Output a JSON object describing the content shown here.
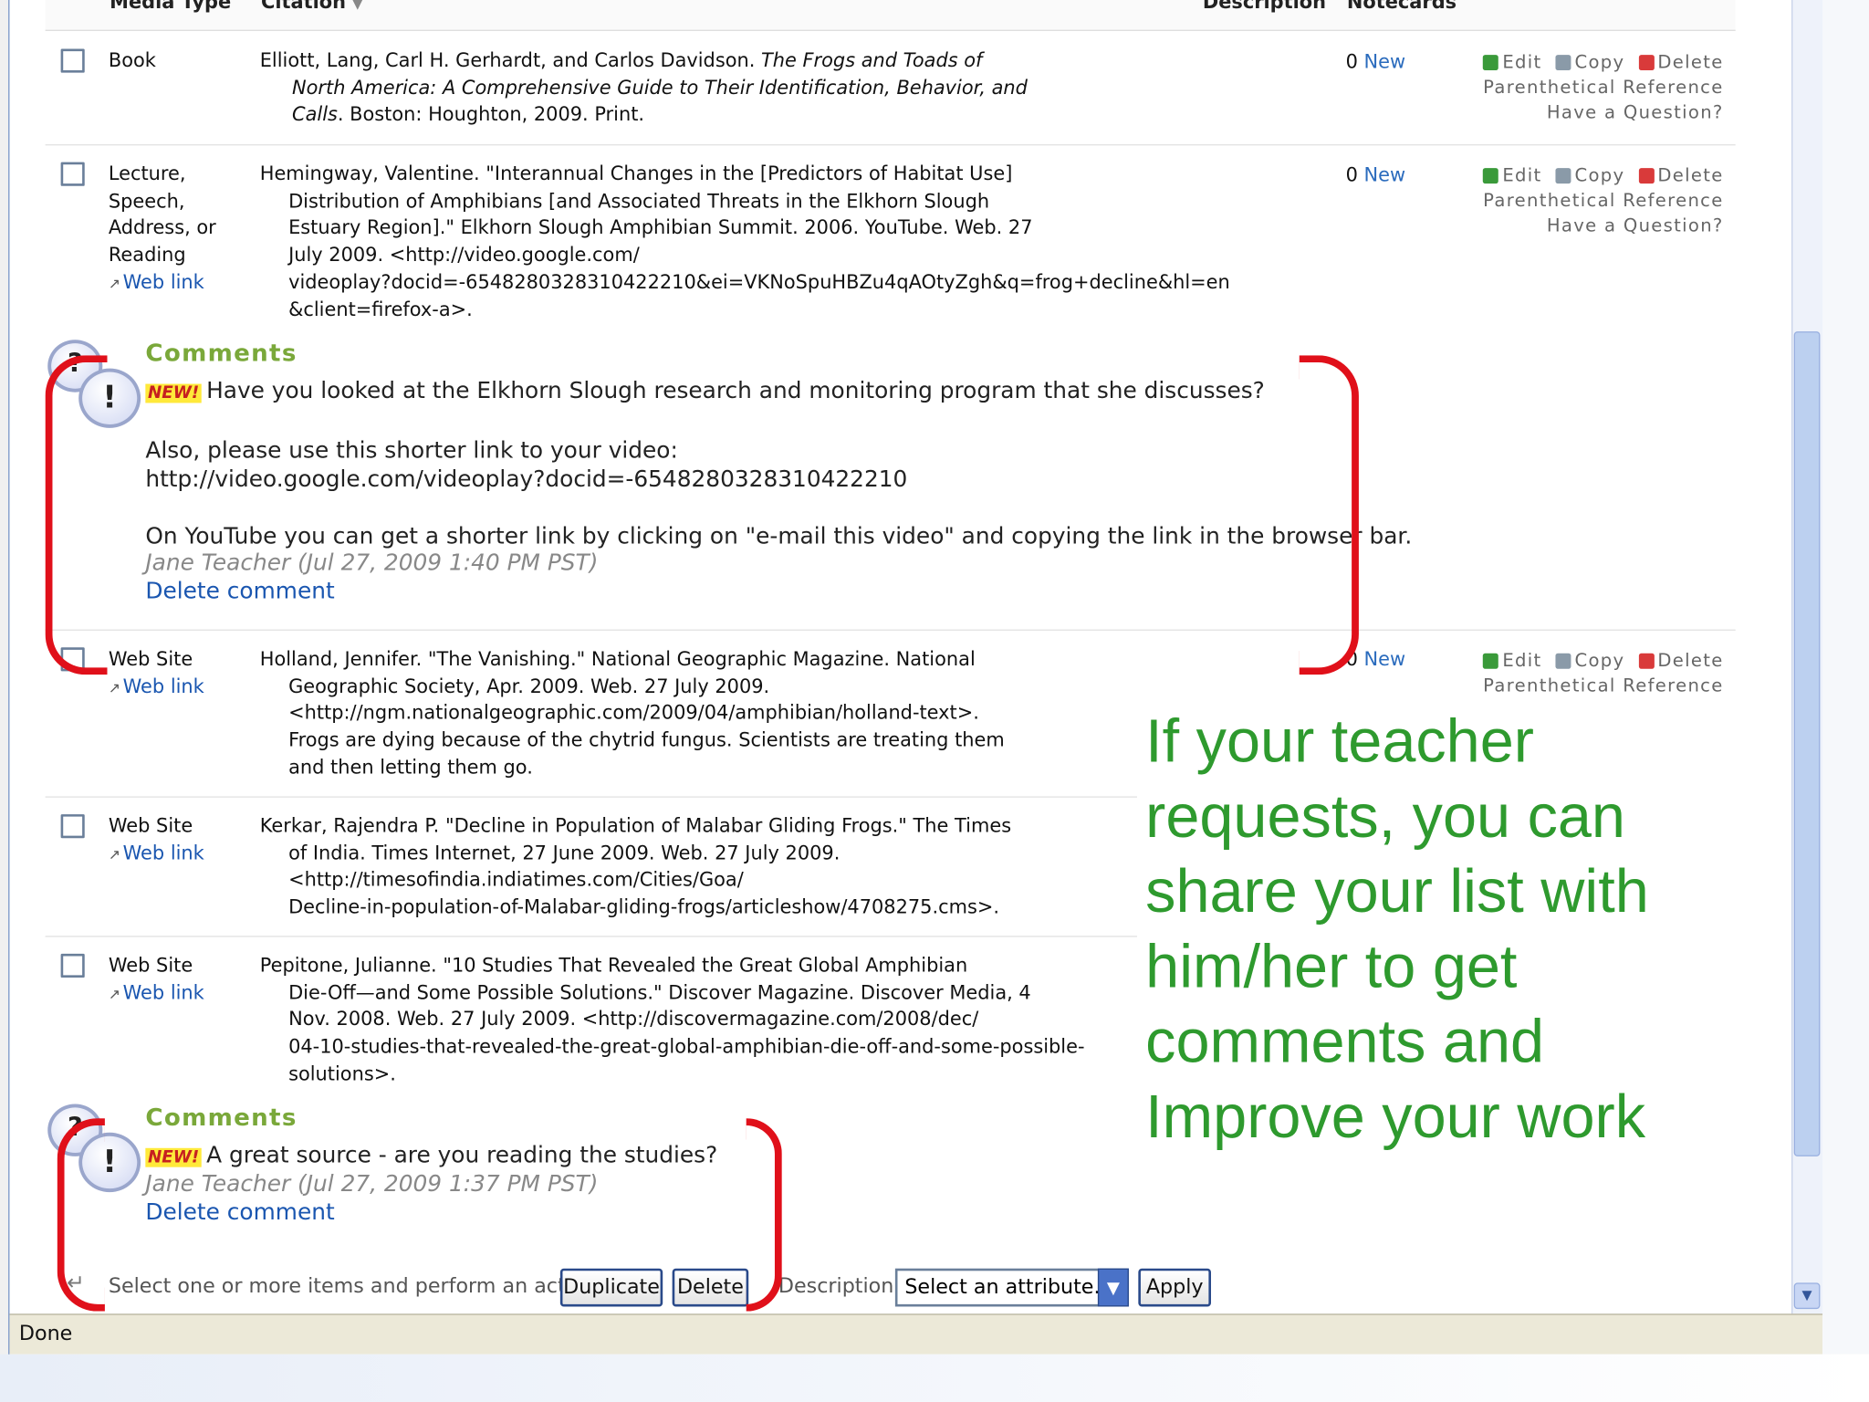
{
  "headers": {
    "media_type": "Media Type",
    "citation": "Citation",
    "description": "Description",
    "notecards": "Notecards"
  },
  "actions": {
    "edit": "Edit",
    "copy": "Copy",
    "delete": "Delete",
    "paren": "Parenthetical Reference",
    "question": "Have a Question?"
  },
  "web_link": "Web link",
  "rows": [
    {
      "type": [
        "Book"
      ],
      "citation": [
        [
          "Elliott, Lang, Carl H. Gerhardt, and Carlos Davidson. ",
          "The Frogs and Toads of"
        ],
        [
          "North America: A Comprehensive Guide to Their Identification, Behavior, and"
        ],
        [
          "Calls",
          ". Boston: Houghton, 2009. Print."
        ]
      ],
      "notecards": "0",
      "new": "New"
    },
    {
      "type": [
        "Lecture,",
        "Speech,",
        "Address, or",
        "Reading"
      ],
      "citation": [
        "Hemingway, Valentine. \"Interannual Changes in the [Predictors of Habitat Use]",
        "Distribution of Amphibians [and Associated Threats in the Elkhorn Slough",
        "Estuary Region].\" Elkhorn Slough Amphibian Summit. 2006. YouTube. Web. 27",
        "July 2009. <http://video.google.com/",
        "videoplay?docid=-6548280328310422210&ei=VKNoSpuHBZu4qAOtyZgh&q=frog+decline&hl=en",
        "&client=firefox-a>."
      ],
      "notecards": "0",
      "new": "New"
    },
    {
      "type": [
        "Web Site"
      ],
      "citation": [
        "Holland, Jennifer. \"The Vanishing.\" National Geographic Magazine. National",
        "Geographic Society, Apr. 2009. Web. 27 July 2009.",
        "<http://ngm.nationalgeographic.com/2009/04/amphibian/holland-text>.",
        "Frogs are dying because of the chytrid fungus. Scientists are treating them",
        "and then letting them go."
      ],
      "notecards": "0",
      "new": "New"
    },
    {
      "type": [
        "Web Site"
      ],
      "citation": [
        "Kerkar, Rajendra P. \"Decline in Population of Malabar Gliding Frogs.\" The Times",
        "of India. Times Internet, 27 June 2009. Web. 27 July 2009.",
        "<http://timesofindia.indiatimes.com/Cities/Goa/",
        "Decline-in-population-of-Malabar-gliding-frogs/articleshow/4708275.cms>."
      ]
    },
    {
      "type": [
        "Web Site"
      ],
      "citation": [
        "Pepitone, Julianne. \"10 Studies That Revealed the Great Global Amphibian",
        "Die-Off—and Some Possible Solutions.\" Discover Magazine. Discover Media, 4",
        "Nov. 2008. Web. 27 July 2009. <http://discovermagazine.com/2008/dec/",
        "04-10-studies-that-revealed-the-great-global-amphibian-die-off-and-some-possible-",
        "solutions>."
      ]
    }
  ],
  "comments": [
    {
      "title": "Comments",
      "new": "NEW!",
      "lines": [
        "Have you looked at the Elkhorn Slough research and monitoring program that she discusses?",
        "Also, please use this shorter link to your video:",
        "http://video.google.com/videoplay?docid=-6548280328310422210",
        "On YouTube you can get a shorter link by clicking on \"e-mail this video\" and copying the link in the browser bar."
      ],
      "author": "Jane Teacher (Jul 27, 2009 1:40 PM PST)",
      "delete": "Delete comment"
    },
    {
      "title": "Comments",
      "new": "NEW!",
      "lines": [
        "A great source - are you reading the studies?"
      ],
      "author": "Jane Teacher (Jul 27, 2009 1:37 PM PST)",
      "delete": "Delete comment"
    }
  ],
  "overlay_text": [
    "If your teacher",
    "requests, you can",
    "share your list with",
    "him/her to get",
    "comments and",
    "Improve your work"
  ],
  "footer": {
    "prompt": "Select one or more items and perform an action:",
    "duplicate": "Duplicate",
    "delete": "Delete",
    "description_label": "Description:",
    "select_value": "Select an attribute...",
    "apply": "Apply"
  },
  "status": "Done",
  "colors": {
    "bracket": "#e0101a",
    "overlay_text": "#2e9a2e",
    "link": "#1a56b0",
    "comments_title": "#7aa83a"
  }
}
